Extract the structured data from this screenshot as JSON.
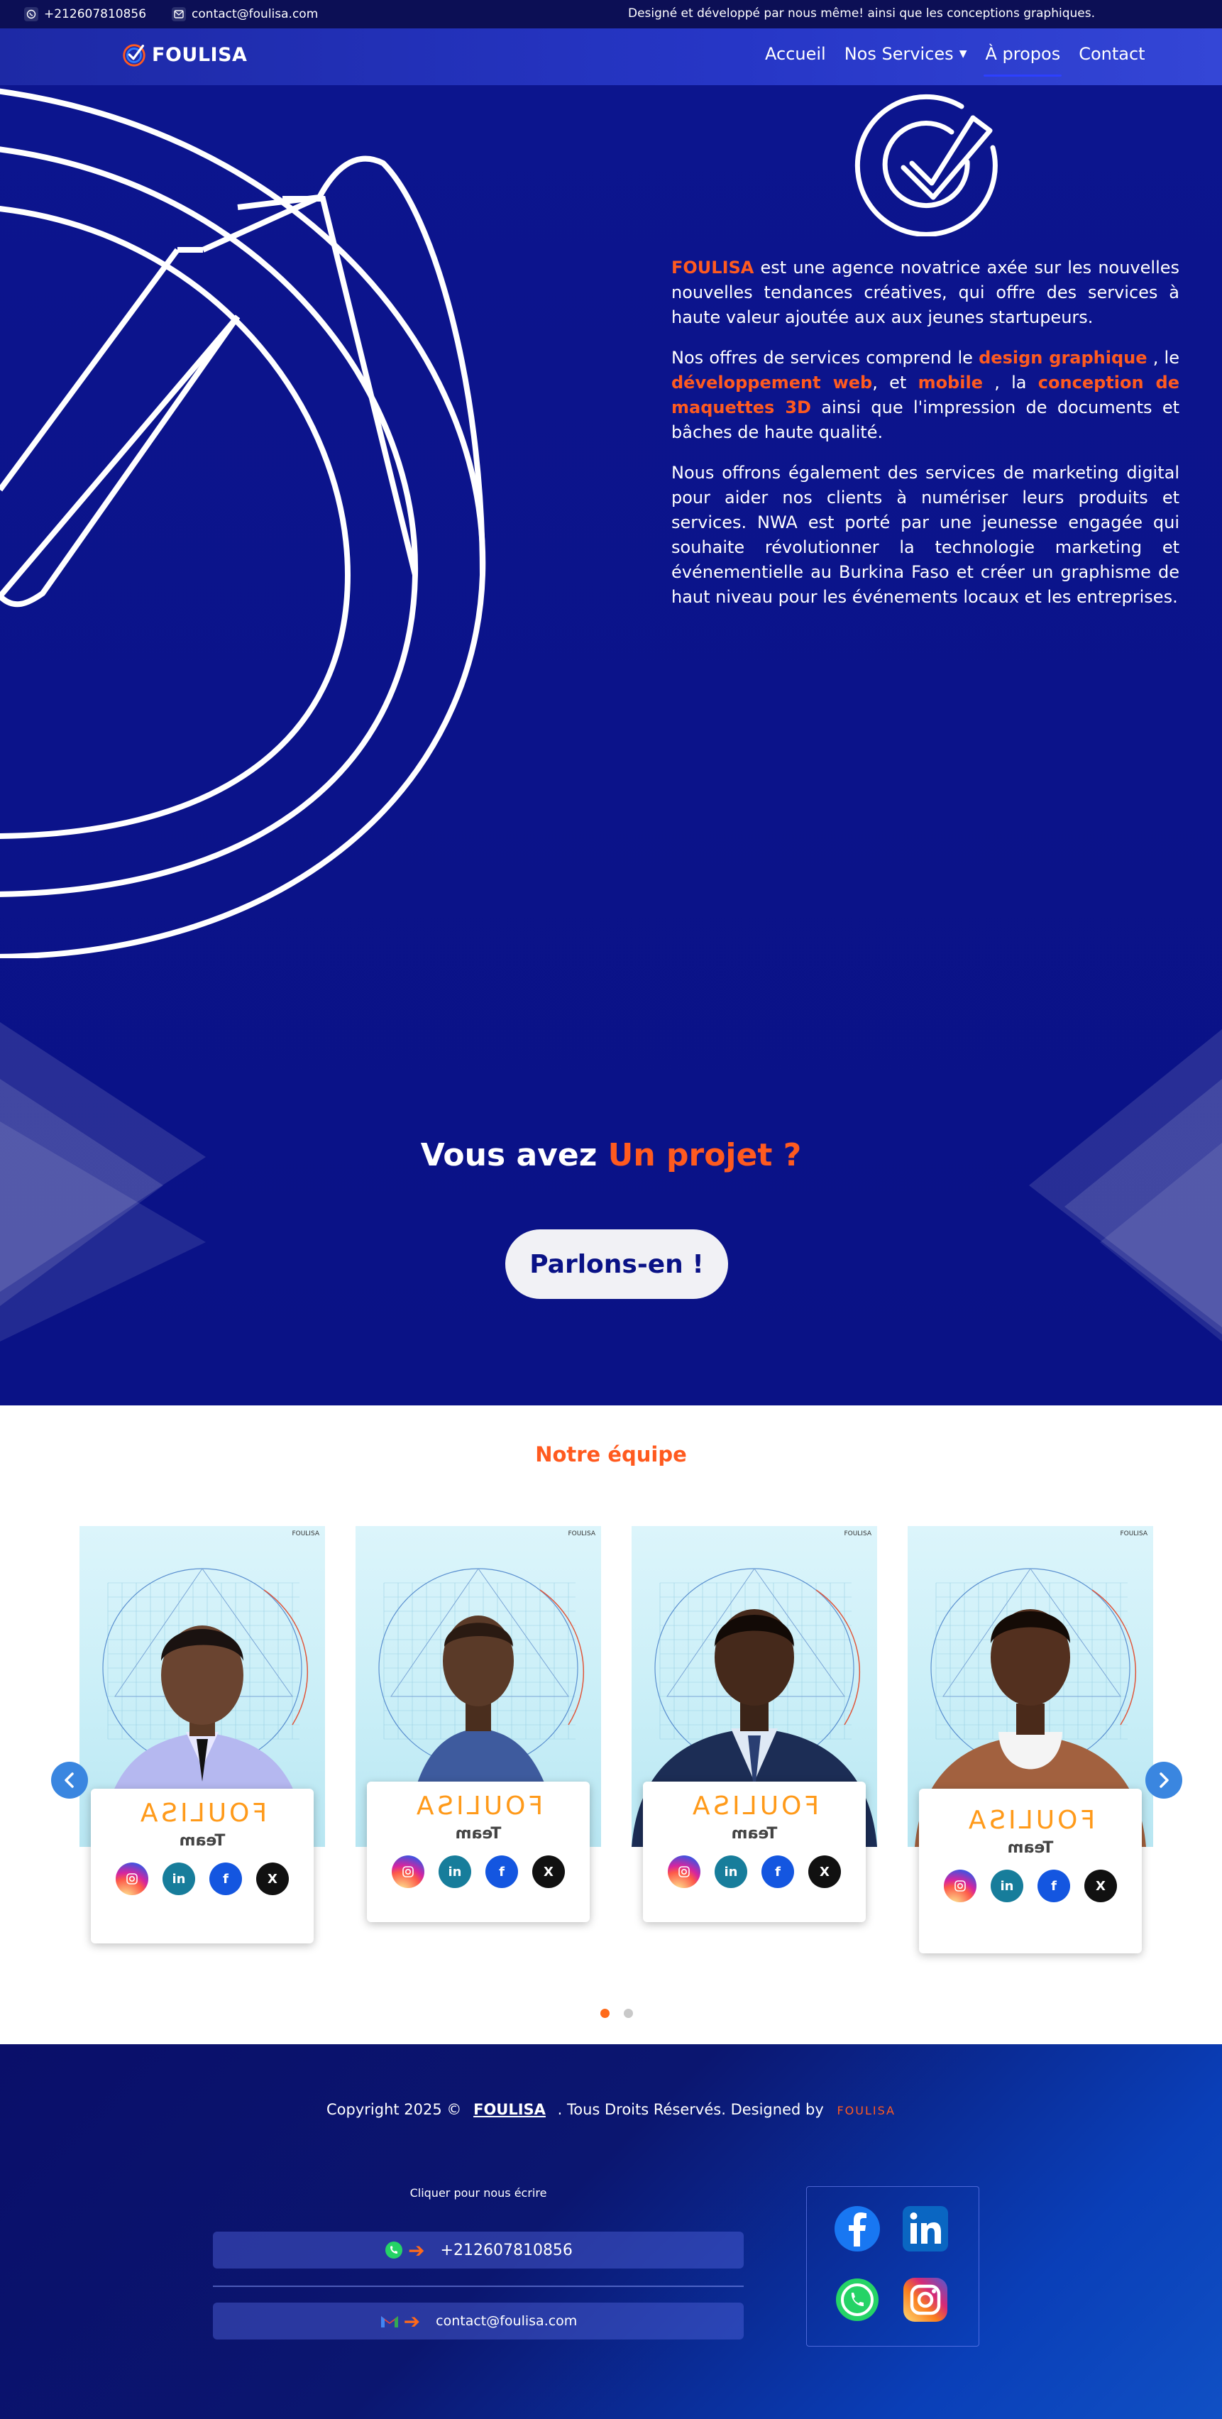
{
  "topbar": {
    "phone": "+212607810856",
    "email": "contact@foulisa.com",
    "tagline": "Designé et développé par nous même! ainsi que les conceptions graphiques."
  },
  "nav": {
    "brand": "FOULISA",
    "items": [
      {
        "label": "Accueil"
      },
      {
        "label": "Nos Services"
      },
      {
        "label": "À propos"
      },
      {
        "label": "Contact"
      }
    ],
    "active": "À propos"
  },
  "about": {
    "p1_brand": "FOULISA",
    "p1_text": " est une agence novatrice axée sur les nouvelles nouvelles tendances créatives, qui offre des services à haute valeur ajoutée aux aux jeunes startupeurs.",
    "p2_a": "Nos offres de services comprend le ",
    "p2_hl1": "design graphique",
    "p2_b": " , le ",
    "p2_hl2": "développement web",
    "p2_c": ", et ",
    "p2_hl3": "mobile",
    "p2_d": " , la ",
    "p2_hl4": "conception de maquettes 3D",
    "p2_e": " ainsi que l'impression de documents et bâches de haute qualité.",
    "p3": "Nous offrons également des services de marketing digital pour aider nos clients à numériser leurs produits et services. NWA est porté par une jeunesse engagée qui souhaite révolutionner la technologie marketing et événementielle au Burkina Faso et créer un graphisme de haut niveau pour les événements locaux et les entreprises."
  },
  "cta": {
    "title_a": "Vous avez ",
    "title_b": "Un projet ?",
    "button": "Parlons-en !"
  },
  "team": {
    "title": "Notre équipe",
    "members": [
      {
        "brand": "FOULISA",
        "role": "Team",
        "mini": "FOULISA"
      },
      {
        "brand": "FOULISA",
        "role": "Team",
        "mini": "FOULISA"
      },
      {
        "brand": "FOULISA",
        "role": "Team",
        "mini": "FOULISA"
      },
      {
        "brand": "FOULISA",
        "role": "Team",
        "mini": "FOULISA"
      }
    ],
    "social_icons": [
      "instagram-icon",
      "linkedin-icon",
      "facebook-icon",
      "x-icon"
    ],
    "social_glyphs": {
      "in": "in",
      "fb": "f",
      "x": "X"
    },
    "active_page": 1,
    "pages": 2
  },
  "footer": {
    "copyright": "Copyright 2025 ©",
    "brand": "FOULISA",
    "rights": ". Tous Droits Réservés. Designed by",
    "designer": "FOULISA",
    "write_label": "Cliquer pour nous écrire",
    "phone": "+212607810856",
    "email": "contact@foulisa.com"
  },
  "colors": {
    "accent": "#ff5a1f",
    "navy": "#0b1287",
    "brand_orange": "#ff9a1a"
  }
}
